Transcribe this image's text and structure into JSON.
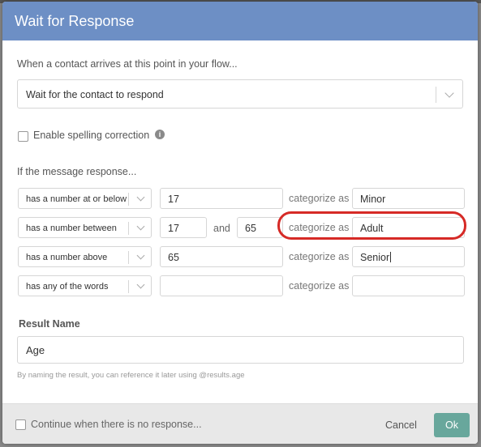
{
  "modal": {
    "title": "Wait for Response"
  },
  "flow": {
    "label": "When a contact arrives at this point in your flow...",
    "selected": "Wait for the contact to respond"
  },
  "spelling": {
    "label": "Enable spelling correction",
    "checked": false,
    "info_icon": "i"
  },
  "rules": {
    "intro": "If the message response...",
    "categorize_label": "categorize as",
    "and_label": "and",
    "items": [
      {
        "operator": "has a number at or below",
        "value": "17",
        "category": "Minor"
      },
      {
        "operator": "has a number between",
        "min": "17",
        "max": "65",
        "category": "Adult"
      },
      {
        "operator": "has a number above",
        "value": "65",
        "category": "Senior"
      },
      {
        "operator": "has any of the words",
        "value": "",
        "category": ""
      }
    ]
  },
  "result": {
    "label": "Result Name",
    "value": "Age",
    "hint": "By naming the result, you can reference it later using @results.age"
  },
  "footer": {
    "continue_label": "Continue when there is no response...",
    "continue_checked": false,
    "cancel_label": "Cancel",
    "ok_label": "Ok"
  },
  "colors": {
    "header": "#6d8fc5",
    "ok_button": "#68a79c",
    "highlight": "#d62a26"
  }
}
